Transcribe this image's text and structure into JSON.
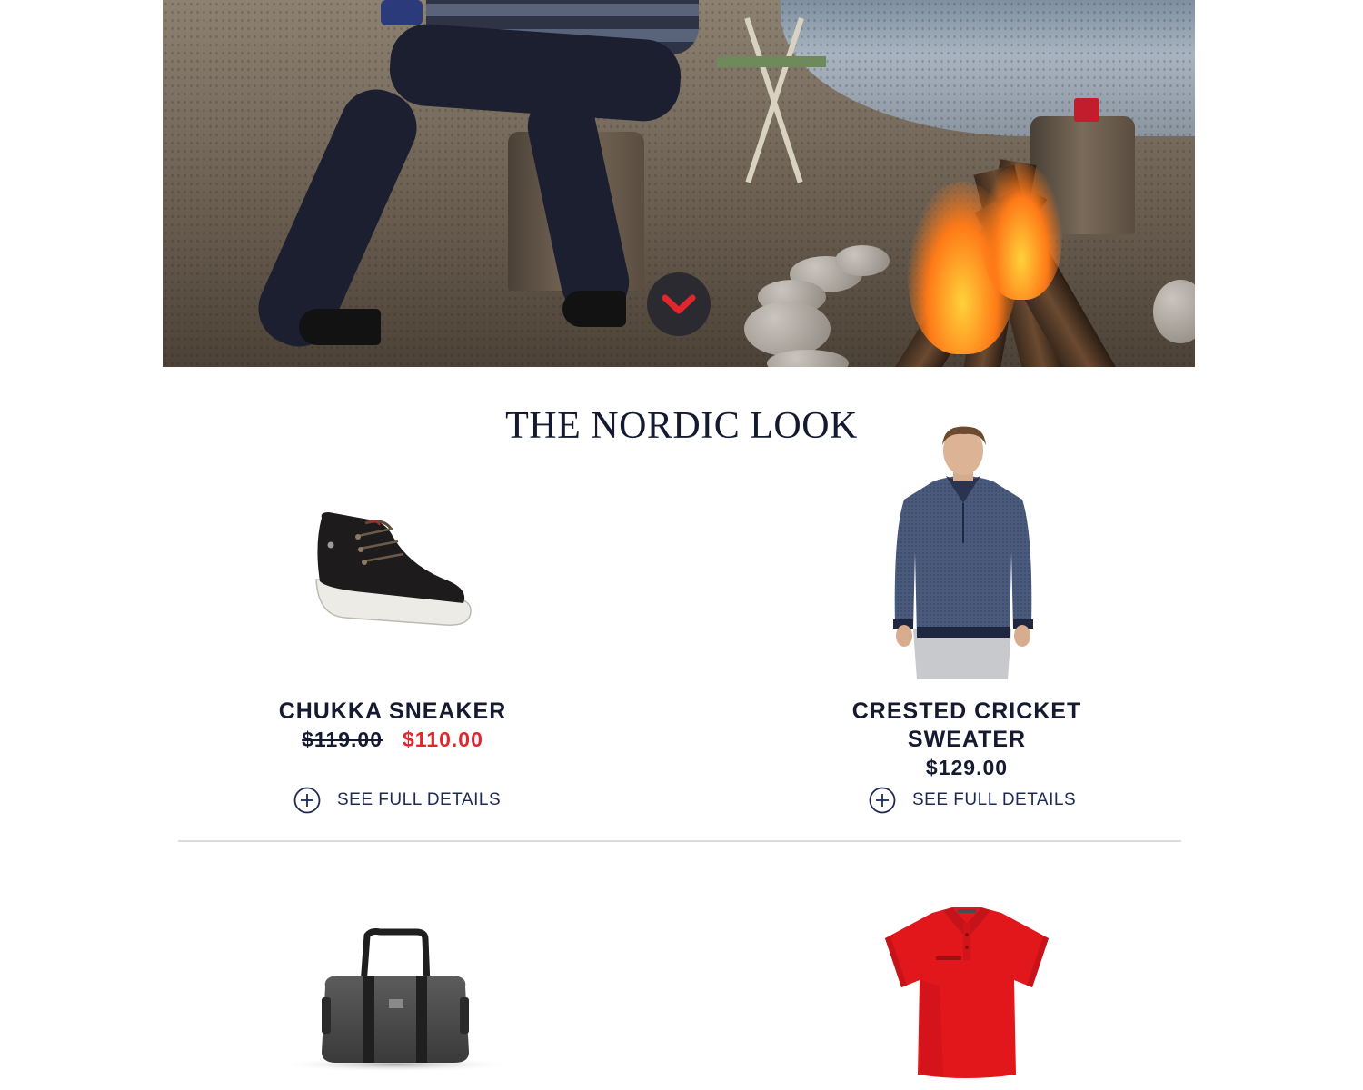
{
  "hero": {
    "image_subject": "beach-campfire-scene",
    "scroll_icon": "chevron-down-icon",
    "colors": {
      "scroll_button_bg": "#2a2a30",
      "chevron": "#e1262d"
    }
  },
  "section": {
    "title": "THE NORDIC LOOK"
  },
  "products": [
    {
      "name": "CHUKKA SNEAKER",
      "price_original": "$119.00",
      "price_sale": "$110.00",
      "details_label": "SEE FULL DETAILS",
      "details_icon": "plus-circle-icon"
    },
    {
      "name_line1": "CRESTED CRICKET",
      "name_line2": "SWEATER",
      "price": "$129.00",
      "details_label": "SEE FULL DETAILS",
      "details_icon": "plus-circle-icon"
    },
    {
      "image_subject": "duffel-bag"
    },
    {
      "image_subject": "red-polo-shirt"
    }
  ],
  "colors": {
    "navy": "#141a30",
    "sale_red": "#e1262d",
    "link": "#1e2a55",
    "divider": "#dcdcdc"
  }
}
